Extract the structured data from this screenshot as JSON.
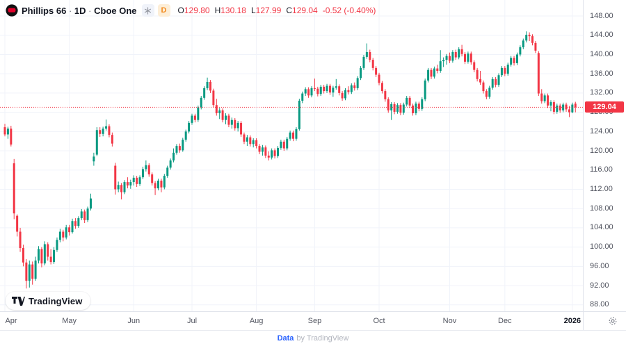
{
  "header": {
    "symbol": "Phillips 66",
    "separator": "·",
    "interval": "1D",
    "exchange": "Cboe One",
    "interval_badge": "D",
    "icons": {
      "logo": "phillips66-logo",
      "snowflake": "snowflake-icon"
    },
    "ohlc": {
      "o_label": "O",
      "o": "129.80",
      "h_label": "H",
      "h": "130.18",
      "l_label": "L",
      "l": "127.99",
      "c_label": "C",
      "c": "129.04",
      "change": "-0.52 (-0.40%)"
    }
  },
  "price_axis": {
    "ticks": [
      "148.00",
      "144.00",
      "140.00",
      "136.00",
      "132.00",
      "128.00",
      "124.00",
      "120.00",
      "116.00",
      "112.00",
      "108.00",
      "104.00",
      "100.00",
      "96.00",
      "92.00",
      "88.00"
    ],
    "last_price_label": "129.04"
  },
  "time_axis": {
    "ticks": [
      {
        "label": "Apr",
        "index": 0,
        "emphasis": false
      },
      {
        "label": "May",
        "index": 21,
        "emphasis": false
      },
      {
        "label": "Jun",
        "index": 42,
        "emphasis": false
      },
      {
        "label": "Jul",
        "index": 61,
        "emphasis": false
      },
      {
        "label": "Aug",
        "index": 82,
        "emphasis": false
      },
      {
        "label": "Sep",
        "index": 101,
        "emphasis": false
      },
      {
        "label": "Oct",
        "index": 122,
        "emphasis": false
      },
      {
        "label": "Nov",
        "index": 145,
        "emphasis": false
      },
      {
        "label": "Dec",
        "index": 163,
        "emphasis": false
      },
      {
        "label": "2026",
        "index": 185,
        "emphasis": true
      }
    ]
  },
  "logo_pill": {
    "label": "TradingView"
  },
  "footer": {
    "data_label": "Data",
    "attribution": "by TradingView"
  },
  "colors": {
    "up": "#089981",
    "down": "#f23645",
    "grid": "#f0f3fa",
    "axis_border": "#e0e3eb",
    "axis_text": "#51545f",
    "tag_bg": "#f23645",
    "link_blue": "#2962ff",
    "dark_text": "#131722"
  },
  "chart_data": {
    "type": "candlestick",
    "title": "Phillips 66 · 1D · Cboe One",
    "interval": "1D",
    "last_close": 129.04,
    "change": -0.52,
    "change_pct": -0.4,
    "price_line": 129.04,
    "ylim": [
      86.5,
      151.3
    ],
    "price_ticks": [
      88,
      92,
      96,
      100,
      104,
      108,
      112,
      116,
      120,
      124,
      128,
      132,
      136,
      140,
      144,
      148
    ],
    "legend_position": "top-left",
    "grid": true,
    "months": [
      "Apr",
      "May",
      "Jun",
      "Jul",
      "Aug",
      "Sep",
      "Oct",
      "Nov",
      "Dec",
      "2026"
    ],
    "candles_format": [
      "open",
      "high",
      "low",
      "close"
    ],
    "candles": [
      [
        124.9,
        125.6,
        123.0,
        123.4
      ],
      [
        123.4,
        125.0,
        122.5,
        124.6
      ],
      [
        124.6,
        125.2,
        120.9,
        121.3
      ],
      [
        117.4,
        118.3,
        105.8,
        107.0
      ],
      [
        106.5,
        106.8,
        102.2,
        103.2
      ],
      [
        103.2,
        104.0,
        99.0,
        99.8
      ],
      [
        99.8,
        100.5,
        96.0,
        96.8
      ],
      [
        96.8,
        97.5,
        91.4,
        93.0
      ],
      [
        93.0,
        97.2,
        91.6,
        96.4
      ],
      [
        96.4,
        97.0,
        92.2,
        93.4
      ],
      [
        93.4,
        98.0,
        93.0,
        97.2
      ],
      [
        97.2,
        100.2,
        96.6,
        99.6
      ],
      [
        99.6,
        100.0,
        95.8,
        96.6
      ],
      [
        96.6,
        101.2,
        96.2,
        100.6
      ],
      [
        100.6,
        101.0,
        97.2,
        98.0
      ],
      [
        98.0,
        99.6,
        96.4,
        96.9
      ],
      [
        96.9,
        100.0,
        96.5,
        99.4
      ],
      [
        99.4,
        102.0,
        99.0,
        101.5
      ],
      [
        101.5,
        103.8,
        101.0,
        103.2
      ],
      [
        103.2,
        103.6,
        101.2,
        102.0
      ],
      [
        102.0,
        104.6,
        101.6,
        104.1
      ],
      [
        104.1,
        104.6,
        102.4,
        103.1
      ],
      [
        103.1,
        105.9,
        102.8,
        105.4
      ],
      [
        105.4,
        106.0,
        103.8,
        104.4
      ],
      [
        104.4,
        106.4,
        104.0,
        106.0
      ],
      [
        106.0,
        107.9,
        105.6,
        107.4
      ],
      [
        107.4,
        107.8,
        105.0,
        105.6
      ],
      [
        105.6,
        108.4,
        105.2,
        108.0
      ],
      [
        108.0,
        111.1,
        107.6,
        110.1
      ],
      [
        117.8,
        119.6,
        116.9,
        118.8
      ],
      [
        119.2,
        124.9,
        118.9,
        124.3
      ],
      [
        124.3,
        124.9,
        122.9,
        123.5
      ],
      [
        123.5,
        125.0,
        123.0,
        124.6
      ],
      [
        124.6,
        126.5,
        124.2,
        125.1
      ],
      [
        125.1,
        125.5,
        122.8,
        123.3
      ],
      [
        123.3,
        123.8,
        120.9,
        121.5
      ],
      [
        116.9,
        117.5,
        110.9,
        112.0
      ],
      [
        112.0,
        113.6,
        111.4,
        112.9
      ],
      [
        112.9,
        113.3,
        109.9,
        111.4
      ],
      [
        111.4,
        113.9,
        111.0,
        113.5
      ],
      [
        113.5,
        114.5,
        112.2,
        112.8
      ],
      [
        112.8,
        114.0,
        112.1,
        113.5
      ],
      [
        113.5,
        114.9,
        112.8,
        114.4
      ],
      [
        114.4,
        114.8,
        112.5,
        113.1
      ],
      [
        113.1,
        114.9,
        112.7,
        114.5
      ],
      [
        114.5,
        116.7,
        114.1,
        116.2
      ],
      [
        116.2,
        118.0,
        115.7,
        117.0
      ],
      [
        117.0,
        117.4,
        114.6,
        115.1
      ],
      [
        115.1,
        115.5,
        112.8,
        113.3
      ],
      [
        113.3,
        113.7,
        110.8,
        112.2
      ],
      [
        112.2,
        114.2,
        111.8,
        113.8
      ],
      [
        113.8,
        114.2,
        111.4,
        112.4
      ],
      [
        112.4,
        115.2,
        112.0,
        114.8
      ],
      [
        114.8,
        116.9,
        114.4,
        116.5
      ],
      [
        116.5,
        118.4,
        116.1,
        118.0
      ],
      [
        118.0,
        120.5,
        117.6,
        119.6
      ],
      [
        119.6,
        121.4,
        119.2,
        121.0
      ],
      [
        121.0,
        121.5,
        119.6,
        120.1
      ],
      [
        120.1,
        122.7,
        119.8,
        122.3
      ],
      [
        122.3,
        124.4,
        121.9,
        124.0
      ],
      [
        124.0,
        126.2,
        123.6,
        125.8
      ],
      [
        125.8,
        127.7,
        125.4,
        127.3
      ],
      [
        127.3,
        127.7,
        125.9,
        126.4
      ],
      [
        126.4,
        129.4,
        126.0,
        129.0
      ],
      [
        129.0,
        131.4,
        128.6,
        131.0
      ],
      [
        131.0,
        133.4,
        130.6,
        133.0
      ],
      [
        133.0,
        135.2,
        132.6,
        134.3
      ],
      [
        134.3,
        134.7,
        132.0,
        132.5
      ],
      [
        132.5,
        132.9,
        129.0,
        129.5
      ],
      [
        129.5,
        130.8,
        127.3,
        127.8
      ],
      [
        127.8,
        128.9,
        126.6,
        128.4
      ],
      [
        128.4,
        128.8,
        125.9,
        126.4
      ],
      [
        126.4,
        127.8,
        125.5,
        127.3
      ],
      [
        127.3,
        127.7,
        124.9,
        125.4
      ],
      [
        125.4,
        126.9,
        124.6,
        126.4
      ],
      [
        126.4,
        126.8,
        124.2,
        124.7
      ],
      [
        124.7,
        126.2,
        124.0,
        125.8
      ],
      [
        125.8,
        126.2,
        122.9,
        123.4
      ],
      [
        123.4,
        123.8,
        121.4,
        121.9
      ],
      [
        121.9,
        123.3,
        121.0,
        122.8
      ],
      [
        122.8,
        123.2,
        120.9,
        121.4
      ],
      [
        121.4,
        122.6,
        120.7,
        122.2
      ],
      [
        122.2,
        122.6,
        120.5,
        121.0
      ],
      [
        121.0,
        121.4,
        119.3,
        119.8
      ],
      [
        119.8,
        121.2,
        119.0,
        120.7
      ],
      [
        120.7,
        121.1,
        118.5,
        119.0
      ],
      [
        119.0,
        119.9,
        118.0,
        118.6
      ],
      [
        118.6,
        120.5,
        118.2,
        120.1
      ],
      [
        120.1,
        120.5,
        118.4,
        118.9
      ],
      [
        118.9,
        121.0,
        118.5,
        120.6
      ],
      [
        120.6,
        122.3,
        120.2,
        121.9
      ],
      [
        121.9,
        122.3,
        120.0,
        120.5
      ],
      [
        120.5,
        122.9,
        120.1,
        122.5
      ],
      [
        122.5,
        124.2,
        122.1,
        123.8
      ],
      [
        123.8,
        124.2,
        122.0,
        122.5
      ],
      [
        122.5,
        124.9,
        122.1,
        124.5
      ],
      [
        124.5,
        130.8,
        124.2,
        130.4
      ],
      [
        130.4,
        132.3,
        129.9,
        131.9
      ],
      [
        131.9,
        133.2,
        131.4,
        132.8
      ],
      [
        132.8,
        133.2,
        131.0,
        131.5
      ],
      [
        131.5,
        133.4,
        131.1,
        133.0
      ],
      [
        133.0,
        135.0,
        132.4,
        132.9
      ],
      [
        132.9,
        133.3,
        131.3,
        131.8
      ],
      [
        131.8,
        133.7,
        131.4,
        133.3
      ],
      [
        133.3,
        133.7,
        131.9,
        132.4
      ],
      [
        132.4,
        133.9,
        132.0,
        133.5
      ],
      [
        133.5,
        133.9,
        131.6,
        132.1
      ],
      [
        132.1,
        133.5,
        131.2,
        133.1
      ],
      [
        133.1,
        134.9,
        132.7,
        133.4
      ],
      [
        133.4,
        133.8,
        131.5,
        132.0
      ],
      [
        132.0,
        132.4,
        130.4,
        130.9
      ],
      [
        130.9,
        133.0,
        130.5,
        132.6
      ],
      [
        132.6,
        133.4,
        131.7,
        132.2
      ],
      [
        132.2,
        134.0,
        131.8,
        133.6
      ],
      [
        133.6,
        134.2,
        132.5,
        133.0
      ],
      [
        133.0,
        135.5,
        132.6,
        135.1
      ],
      [
        135.1,
        137.6,
        134.7,
        137.2
      ],
      [
        137.2,
        139.9,
        136.8,
        139.5
      ],
      [
        139.5,
        142.3,
        139.1,
        140.5
      ],
      [
        140.5,
        141.0,
        138.4,
        138.9
      ],
      [
        138.9,
        139.3,
        136.7,
        137.2
      ],
      [
        137.2,
        137.6,
        135.3,
        135.8
      ],
      [
        135.8,
        136.2,
        133.6,
        134.1
      ],
      [
        134.1,
        134.5,
        131.9,
        132.4
      ],
      [
        132.4,
        132.8,
        130.2,
        130.7
      ],
      [
        130.7,
        131.1,
        127.9,
        128.4
      ],
      [
        128.4,
        130.1,
        126.4,
        129.7
      ],
      [
        129.7,
        130.1,
        127.6,
        128.1
      ],
      [
        128.1,
        129.9,
        127.7,
        129.5
      ],
      [
        129.5,
        129.9,
        127.4,
        127.9
      ],
      [
        127.9,
        130.0,
        127.5,
        129.6
      ],
      [
        129.6,
        131.4,
        129.2,
        131.0
      ],
      [
        131.0,
        131.4,
        128.9,
        129.4
      ],
      [
        129.4,
        129.8,
        127.3,
        127.8
      ],
      [
        127.8,
        130.2,
        127.4,
        129.8
      ],
      [
        129.8,
        130.2,
        128.2,
        128.7
      ],
      [
        128.7,
        131.1,
        128.3,
        130.7
      ],
      [
        130.7,
        135.0,
        130.3,
        134.6
      ],
      [
        134.6,
        137.2,
        134.2,
        136.8
      ],
      [
        136.8,
        137.2,
        134.9,
        135.4
      ],
      [
        135.4,
        137.5,
        135.0,
        137.1
      ],
      [
        137.1,
        137.9,
        136.1,
        136.6
      ],
      [
        136.6,
        140.9,
        136.2,
        138.6
      ],
      [
        138.6,
        139.4,
        137.4,
        138.9
      ],
      [
        138.9,
        140.1,
        137.9,
        139.7
      ],
      [
        139.7,
        140.4,
        138.2,
        138.7
      ],
      [
        138.7,
        140.9,
        138.3,
        140.5
      ],
      [
        140.5,
        141.0,
        138.9,
        139.4
      ],
      [
        139.4,
        141.5,
        139.0,
        141.1
      ],
      [
        141.1,
        142.0,
        139.6,
        140.1
      ],
      [
        140.1,
        140.5,
        138.0,
        138.5
      ],
      [
        138.5,
        140.6,
        138.1,
        140.2
      ],
      [
        140.2,
        140.6,
        137.9,
        138.4
      ],
      [
        138.4,
        138.8,
        136.3,
        136.8
      ],
      [
        136.8,
        137.2,
        134.4,
        134.9
      ],
      [
        134.9,
        136.6,
        133.7,
        134.2
      ],
      [
        134.2,
        134.6,
        131.9,
        132.4
      ],
      [
        132.4,
        132.8,
        130.7,
        131.2
      ],
      [
        131.2,
        133.5,
        130.8,
        133.1
      ],
      [
        133.1,
        135.3,
        132.7,
        134.9
      ],
      [
        134.9,
        135.3,
        133.2,
        133.7
      ],
      [
        133.7,
        136.1,
        133.3,
        135.7
      ],
      [
        135.7,
        137.6,
        135.3,
        137.2
      ],
      [
        137.2,
        137.6,
        135.5,
        136.0
      ],
      [
        136.0,
        138.3,
        135.6,
        137.9
      ],
      [
        137.9,
        139.7,
        137.5,
        139.3
      ],
      [
        139.3,
        139.7,
        137.7,
        138.2
      ],
      [
        138.2,
        140.4,
        137.8,
        140.0
      ],
      [
        140.0,
        141.9,
        139.6,
        141.5
      ],
      [
        141.5,
        143.3,
        141.1,
        142.9
      ],
      [
        142.9,
        144.8,
        142.5,
        144.1
      ],
      [
        144.1,
        144.6,
        142.8,
        143.8
      ],
      [
        143.8,
        144.2,
        141.9,
        142.4
      ],
      [
        142.4,
        142.8,
        140.3,
        140.8
      ],
      [
        140.3,
        140.7,
        131.4,
        131.9
      ],
      [
        131.9,
        132.8,
        129.8,
        130.3
      ],
      [
        130.3,
        131.9,
        129.9,
        131.5
      ],
      [
        131.5,
        131.9,
        128.9,
        129.4
      ],
      [
        129.4,
        130.5,
        128.2,
        130.1
      ],
      [
        130.1,
        130.5,
        127.6,
        128.1
      ],
      [
        128.1,
        129.8,
        127.7,
        129.4
      ],
      [
        129.4,
        129.8,
        127.9,
        128.4
      ],
      [
        128.4,
        130.0,
        128.0,
        129.6
      ],
      [
        129.6,
        130.0,
        128.1,
        128.6
      ],
      [
        128.6,
        129.3,
        127.0,
        128.0
      ],
      [
        128.0,
        130.0,
        127.8,
        129.6
      ],
      [
        129.8,
        130.18,
        127.99,
        129.04
      ]
    ]
  }
}
